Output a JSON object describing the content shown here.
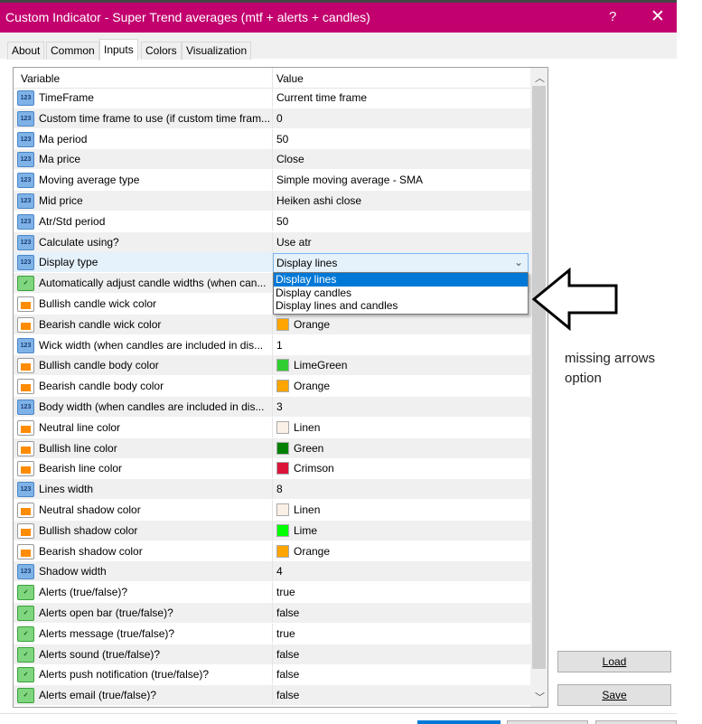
{
  "window": {
    "title": "Custom Indicator - Super Trend averages (mtf + alerts + candles)",
    "help": "?",
    "close": "✕"
  },
  "tabs": [
    {
      "label": "About"
    },
    {
      "label": "Common"
    },
    {
      "label": "Inputs",
      "active": true
    },
    {
      "label": "Colors"
    },
    {
      "label": "Visualization"
    }
  ],
  "grid": {
    "headers": [
      "Variable",
      "Value"
    ],
    "rows": [
      {
        "icon": "num",
        "name": "TimeFrame",
        "value": "Current time frame"
      },
      {
        "icon": "num",
        "name": "Custom time frame to use (if custom time fram...",
        "value": "0"
      },
      {
        "icon": "num",
        "name": "Ma period",
        "value": "50"
      },
      {
        "icon": "num",
        "name": "Ma price",
        "value": "Close"
      },
      {
        "icon": "num",
        "name": "Moving average type",
        "value": "Simple moving average - SMA"
      },
      {
        "icon": "num",
        "name": "Mid price",
        "value": "Heiken ashi close"
      },
      {
        "icon": "num",
        "name": "Atr/Std period",
        "value": "50"
      },
      {
        "icon": "num",
        "name": "Calculate using?",
        "value": "Use atr"
      },
      {
        "icon": "num",
        "name": "Display type",
        "value": "",
        "selected": true
      },
      {
        "icon": "bool",
        "name": "Automatically adjust candle widths (when can...",
        "value": ""
      },
      {
        "icon": "col",
        "name": "Bullish candle wick color",
        "value": ""
      },
      {
        "icon": "col",
        "name": "Bearish candle wick color",
        "value": "Orange",
        "swatch": "#ffa500"
      },
      {
        "icon": "num",
        "name": "Wick width (when candles are included in dis...",
        "value": "1"
      },
      {
        "icon": "col",
        "name": "Bullish candle body color",
        "value": "LimeGreen",
        "swatch": "#32cd32"
      },
      {
        "icon": "col",
        "name": "Bearish candle body color",
        "value": "Orange",
        "swatch": "#ffa500"
      },
      {
        "icon": "num",
        "name": "Body width (when candles are included in dis...",
        "value": "3"
      },
      {
        "icon": "col",
        "name": "Neutral line color",
        "value": "Linen",
        "swatch": "#faf0e6"
      },
      {
        "icon": "col",
        "name": "Bullish line color",
        "value": "Green",
        "swatch": "#008000"
      },
      {
        "icon": "col",
        "name": "Bearish line color",
        "value": "Crimson",
        "swatch": "#dc143c"
      },
      {
        "icon": "num",
        "name": "Lines width",
        "value": "8"
      },
      {
        "icon": "col",
        "name": "Neutral shadow color",
        "value": "Linen",
        "swatch": "#faf0e6"
      },
      {
        "icon": "col",
        "name": "Bullish shadow color",
        "value": "Lime",
        "swatch": "#00ff00"
      },
      {
        "icon": "col",
        "name": "Bearish shadow color",
        "value": "Orange",
        "swatch": "#ffa500"
      },
      {
        "icon": "num",
        "name": "Shadow width",
        "value": "4"
      },
      {
        "icon": "bool",
        "name": "Alerts (true/false)?",
        "value": "true"
      },
      {
        "icon": "bool",
        "name": "Alerts open bar (true/false)?",
        "value": "false"
      },
      {
        "icon": "bool",
        "name": "Alerts message (true/false)?",
        "value": "true"
      },
      {
        "icon": "bool",
        "name": "Alerts sound (true/false)?",
        "value": "false"
      },
      {
        "icon": "bool",
        "name": "Alerts push notification (true/false)?",
        "value": "false"
      },
      {
        "icon": "bool",
        "name": "Alerts email (true/false)?",
        "value": "false"
      }
    ]
  },
  "combo": {
    "value": "Display lines",
    "options": [
      "Display lines",
      "Display candles",
      "Display lines and candles"
    ]
  },
  "buttons": {
    "load": "Load",
    "save": "Save"
  },
  "annotation": {
    "line1": "missing arrows",
    "line2": "option"
  },
  "colors": {
    "titlebar": "#c2006e",
    "highlight": "#0078d7"
  }
}
